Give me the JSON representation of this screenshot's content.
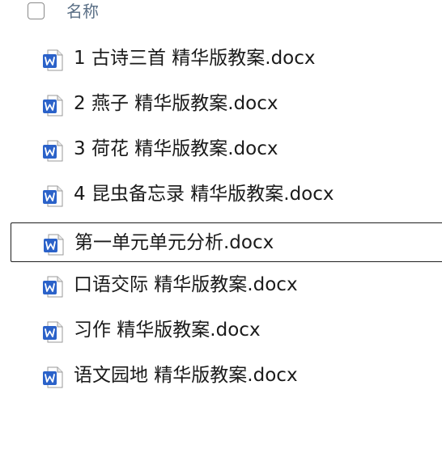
{
  "header": {
    "name_column_label": "名称"
  },
  "files": [
    {
      "name": "1 古诗三首 精华版教案.docx",
      "icon": "word-doc-icon",
      "selected": false
    },
    {
      "name": "2 燕子 精华版教案.docx",
      "icon": "word-doc-icon",
      "selected": false
    },
    {
      "name": "3 荷花 精华版教案.docx",
      "icon": "word-doc-icon",
      "selected": false
    },
    {
      "name": "4 昆虫备忘录 精华版教案.docx",
      "icon": "word-doc-icon",
      "selected": false
    },
    {
      "name": "第一单元单元分析.docx",
      "icon": "word-doc-icon",
      "selected": true
    },
    {
      "name": "口语交际 精华版教案.docx",
      "icon": "word-doc-icon",
      "selected": false
    },
    {
      "name": "习作 精华版教案.docx",
      "icon": "word-doc-icon",
      "selected": false
    },
    {
      "name": "语文园地 精华版教案.docx",
      "icon": "word-doc-icon",
      "selected": false
    }
  ],
  "colors": {
    "word_blue": "#2b62c9",
    "word_dark_blue": "#1e4fae",
    "header_text": "#5a6f86",
    "selection_border": "#1f1f1f"
  }
}
